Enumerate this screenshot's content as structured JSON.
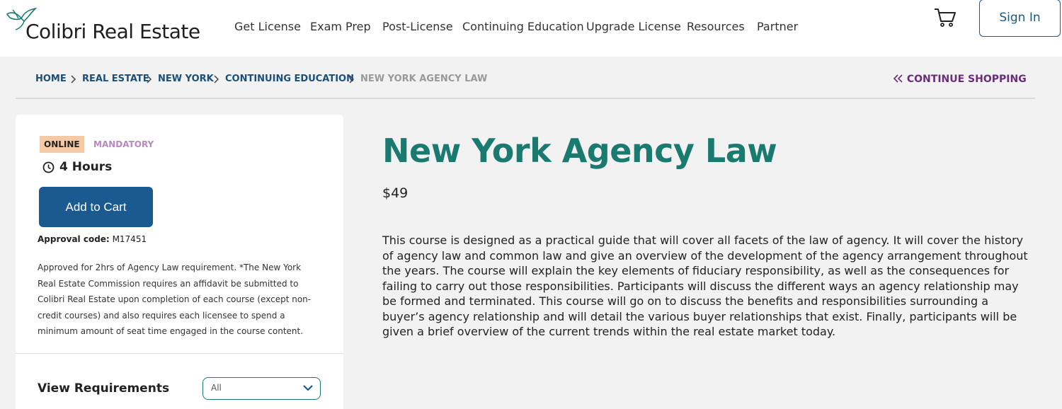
{
  "header": {
    "logo_text": "Colibri Real Estate",
    "nav": [
      {
        "label": "Get License"
      },
      {
        "label": "Exam Prep"
      },
      {
        "label": "Post-License"
      },
      {
        "label": "Continuing Education"
      },
      {
        "label": "Upgrade License"
      },
      {
        "label": "Resources"
      },
      {
        "label": "Partner"
      }
    ],
    "cart_icon": "shopping-cart-icon",
    "signin_label": "Sign In"
  },
  "breadcrumb": {
    "items": [
      "HOME",
      "REAL ESTATE",
      "NEW YORK",
      "CONTINUING EDUCATION",
      "NEW YORK AGENCY LAW"
    ],
    "continue_label": "CONTINUE SHOPPING"
  },
  "course": {
    "badge_online": "ONLINE",
    "badge_mandatory": "MANDATORY",
    "hours": "4 Hours",
    "add_to_cart": "Add to Cart",
    "approval_label": "Approval code:",
    "approval_code": "M17451",
    "approval_desc": "Approved for 2hrs of Agency Law requirement. *The New York Real Estate Commission requires an affidavit be submitted to Colibri Real Estate upon completion of each course (except non-credit courses) and also requires each licensee to spend a minimum amount of seat time engaged in the course content.",
    "view_requirements": "View Requirements",
    "requirements_select": "All",
    "title": "New York Agency Law",
    "price": "$49",
    "description": "This course is designed as a practical guide that will cover all facets of the law of agency. It will cover the history of agency law and common law and give an overview of the development of the agency arrangement throughout the years. The course will explain the key elements of fiduciary responsibility, as well as the consequences for failing to carry out those responsibilities. Participants will discuss the different ways an agency relationship may be formed and terminated. This course will go on to discuss the benefits and responsibilities surrounding a buyer’s agency relationship and will detail the various buyer relationships that exist. Finally, participants will be given a brief overview of the current trends within the real estate market today."
  },
  "colors": {
    "brand_teal": "#1a7a70",
    "primary_blue": "#1b5a90",
    "accent_purple": "#6a2d7a",
    "badge_online_bg": "#f6c9a6",
    "badge_mandatory": "#b68ac1"
  }
}
